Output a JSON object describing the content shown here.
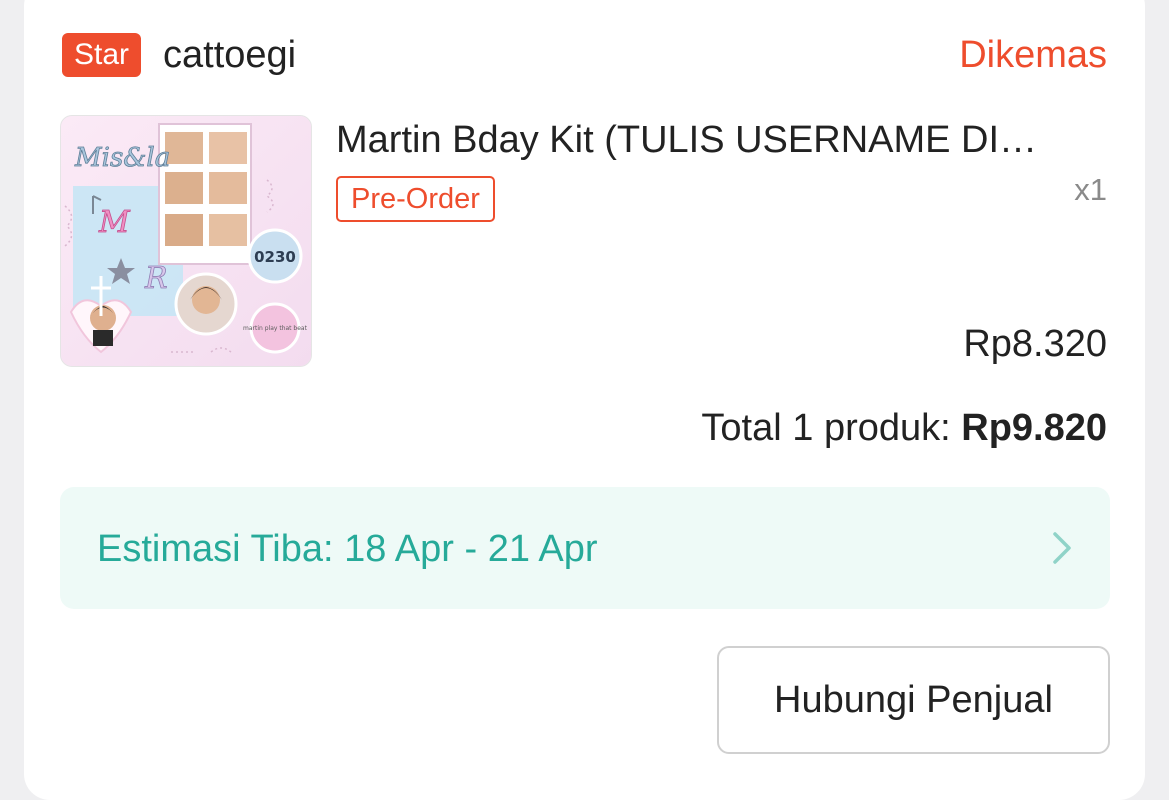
{
  "order": {
    "shop_badge": "Star",
    "shop_name": "cattoegi",
    "status": "Dikemas",
    "status_color": "#ee4d2d"
  },
  "product": {
    "title": "Martin Bday Kit (TULIS USERNAME DI…",
    "tag": "Pre-Order",
    "quantity": "x1",
    "price": "Rp8.320",
    "image_text": {
      "script_title": "Mis&la",
      "code": "0230",
      "button_text": "martin play that beat"
    }
  },
  "summary": {
    "total_label": "Total 1 produk:",
    "total_amount": "Rp9.820"
  },
  "shipping": {
    "estimate_text": "Estimasi Tiba: 18 Apr - 21 Apr",
    "chevron_icon": "chevron-right-icon",
    "accent_color": "#26aa99"
  },
  "actions": {
    "contact_label": "Hubungi Penjual"
  }
}
